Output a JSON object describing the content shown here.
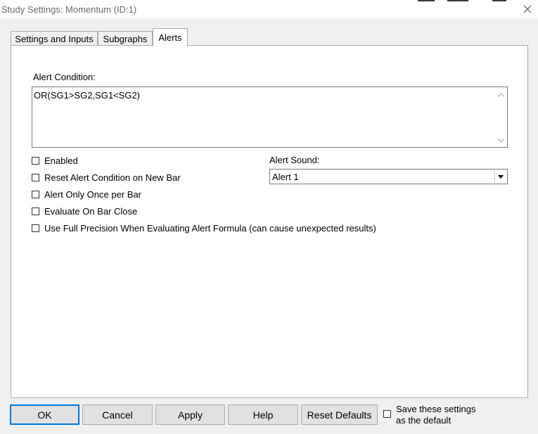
{
  "window": {
    "title": "Study Settings: Momentum (ID:1)",
    "close_icon": "close-icon"
  },
  "tabs": [
    {
      "label": "Settings and Inputs",
      "active": false
    },
    {
      "label": "Subgraphs",
      "active": false
    },
    {
      "label": "Alerts",
      "active": true
    }
  ],
  "alerts": {
    "condition_label": "Alert Condition:",
    "condition_value": "OR(SG1>SG2,SG1<SG2)",
    "checkboxes": [
      {
        "label": "Enabled",
        "checked": false
      },
      {
        "label": "Reset Alert Condition on New Bar",
        "checked": false
      },
      {
        "label": "Alert Only Once per Bar",
        "checked": false
      },
      {
        "label": "Evaluate On Bar Close",
        "checked": false
      },
      {
        "label": "Use Full Precision When Evaluating Alert Formula (can cause unexpected results)",
        "checked": false
      }
    ],
    "sound_label": "Alert Sound:",
    "sound_value": "Alert 1"
  },
  "buttons": {
    "ok": "OK",
    "cancel": "Cancel",
    "apply": "Apply",
    "help": "Help",
    "reset_defaults": "Reset Defaults"
  },
  "save_default": {
    "line1": "Save these settings",
    "line2": "as the default",
    "checked": false
  },
  "colors": {
    "dialog_bg": "#f0f0f0",
    "panel_bg": "#ffffff",
    "default_button_border": "#0078d7"
  }
}
